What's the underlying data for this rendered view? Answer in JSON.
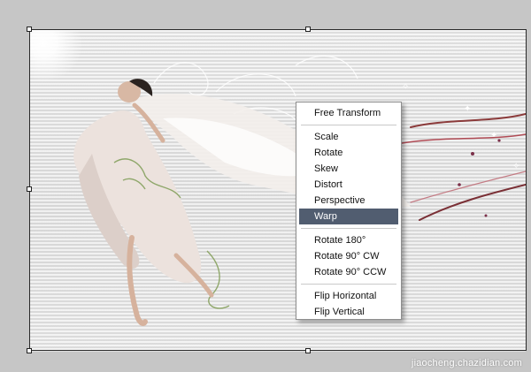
{
  "menu": {
    "items": [
      {
        "label": "Free Transform"
      },
      {
        "label": "Scale"
      },
      {
        "label": "Rotate"
      },
      {
        "label": "Skew"
      },
      {
        "label": "Distort"
      },
      {
        "label": "Perspective"
      },
      {
        "label": "Warp",
        "highlighted": true
      },
      {
        "label": "Rotate 180°"
      },
      {
        "label": "Rotate 90° CW"
      },
      {
        "label": "Rotate 90° CCW"
      },
      {
        "label": "Flip Horizontal"
      },
      {
        "label": "Flip Vertical"
      }
    ]
  },
  "watermark": {
    "text": "jiaocheng.chazidian.com"
  },
  "colors": {
    "menu_highlight": "#515d70",
    "workspace": "#c6c6c6",
    "menu_background": "#ffffff"
  }
}
